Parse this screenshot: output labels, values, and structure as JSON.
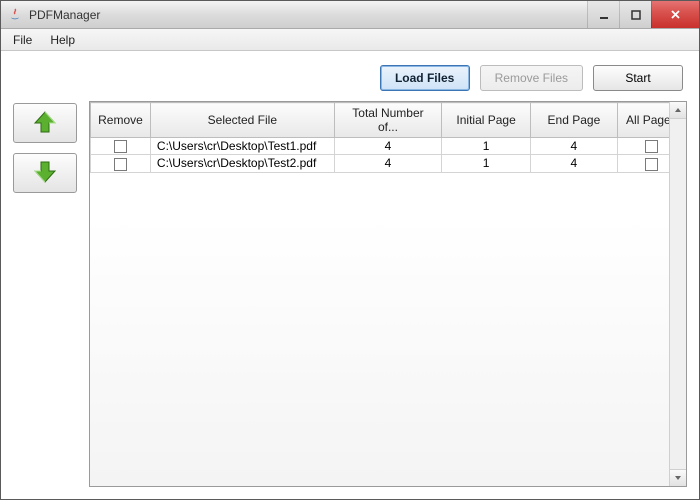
{
  "window": {
    "title": "PDFManager"
  },
  "menubar": {
    "file": "File",
    "help": "Help"
  },
  "toolbar": {
    "load_files": "Load Files",
    "remove_files": "Remove Files",
    "start": "Start"
  },
  "table": {
    "columns": {
      "remove": "Remove",
      "file": "Selected File",
      "total": "Total Number of...",
      "initial": "Initial Page",
      "end": "End Page",
      "all": "All Pages"
    },
    "rows": [
      {
        "remove": false,
        "file": "C:\\Users\\cr\\Desktop\\Test1.pdf",
        "total": "4",
        "initial": "1",
        "end": "4",
        "all": false
      },
      {
        "remove": false,
        "file": "C:\\Users\\cr\\Desktop\\Test2.pdf",
        "total": "4",
        "initial": "1",
        "end": "4",
        "all": false
      }
    ]
  }
}
